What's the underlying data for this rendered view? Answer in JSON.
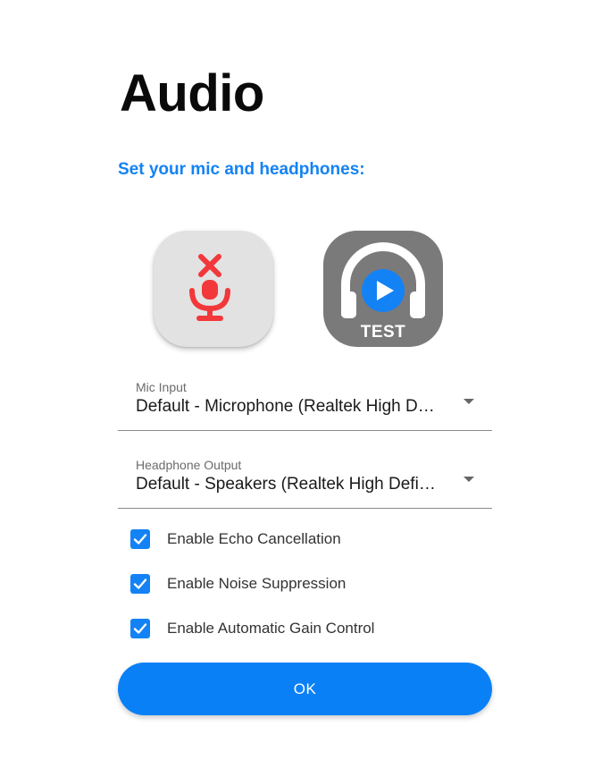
{
  "header": {
    "title": "Audio",
    "subtitle": "Set your mic and headphones:"
  },
  "icons": {
    "mic": "microphone-muted-icon",
    "test": "headphones-play-icon"
  },
  "test_button": {
    "label": "TEST"
  },
  "mic_input": {
    "label": "Mic Input",
    "value": "Default - Microphone (Realtek High Definition Audio)"
  },
  "headphone_output": {
    "label": "Headphone Output",
    "value": "Default - Speakers (Realtek High Definition Audio)"
  },
  "options": [
    {
      "label": "Enable Echo Cancellation",
      "checked": true
    },
    {
      "label": "Enable Noise Suppression",
      "checked": true
    },
    {
      "label": "Enable Automatic Gain Control",
      "checked": true
    }
  ],
  "ok_button": {
    "label": "OK"
  },
  "colors": {
    "accent": "#1382f5",
    "mute_red": "#f2383a",
    "test_bg": "#7a7a7a"
  }
}
